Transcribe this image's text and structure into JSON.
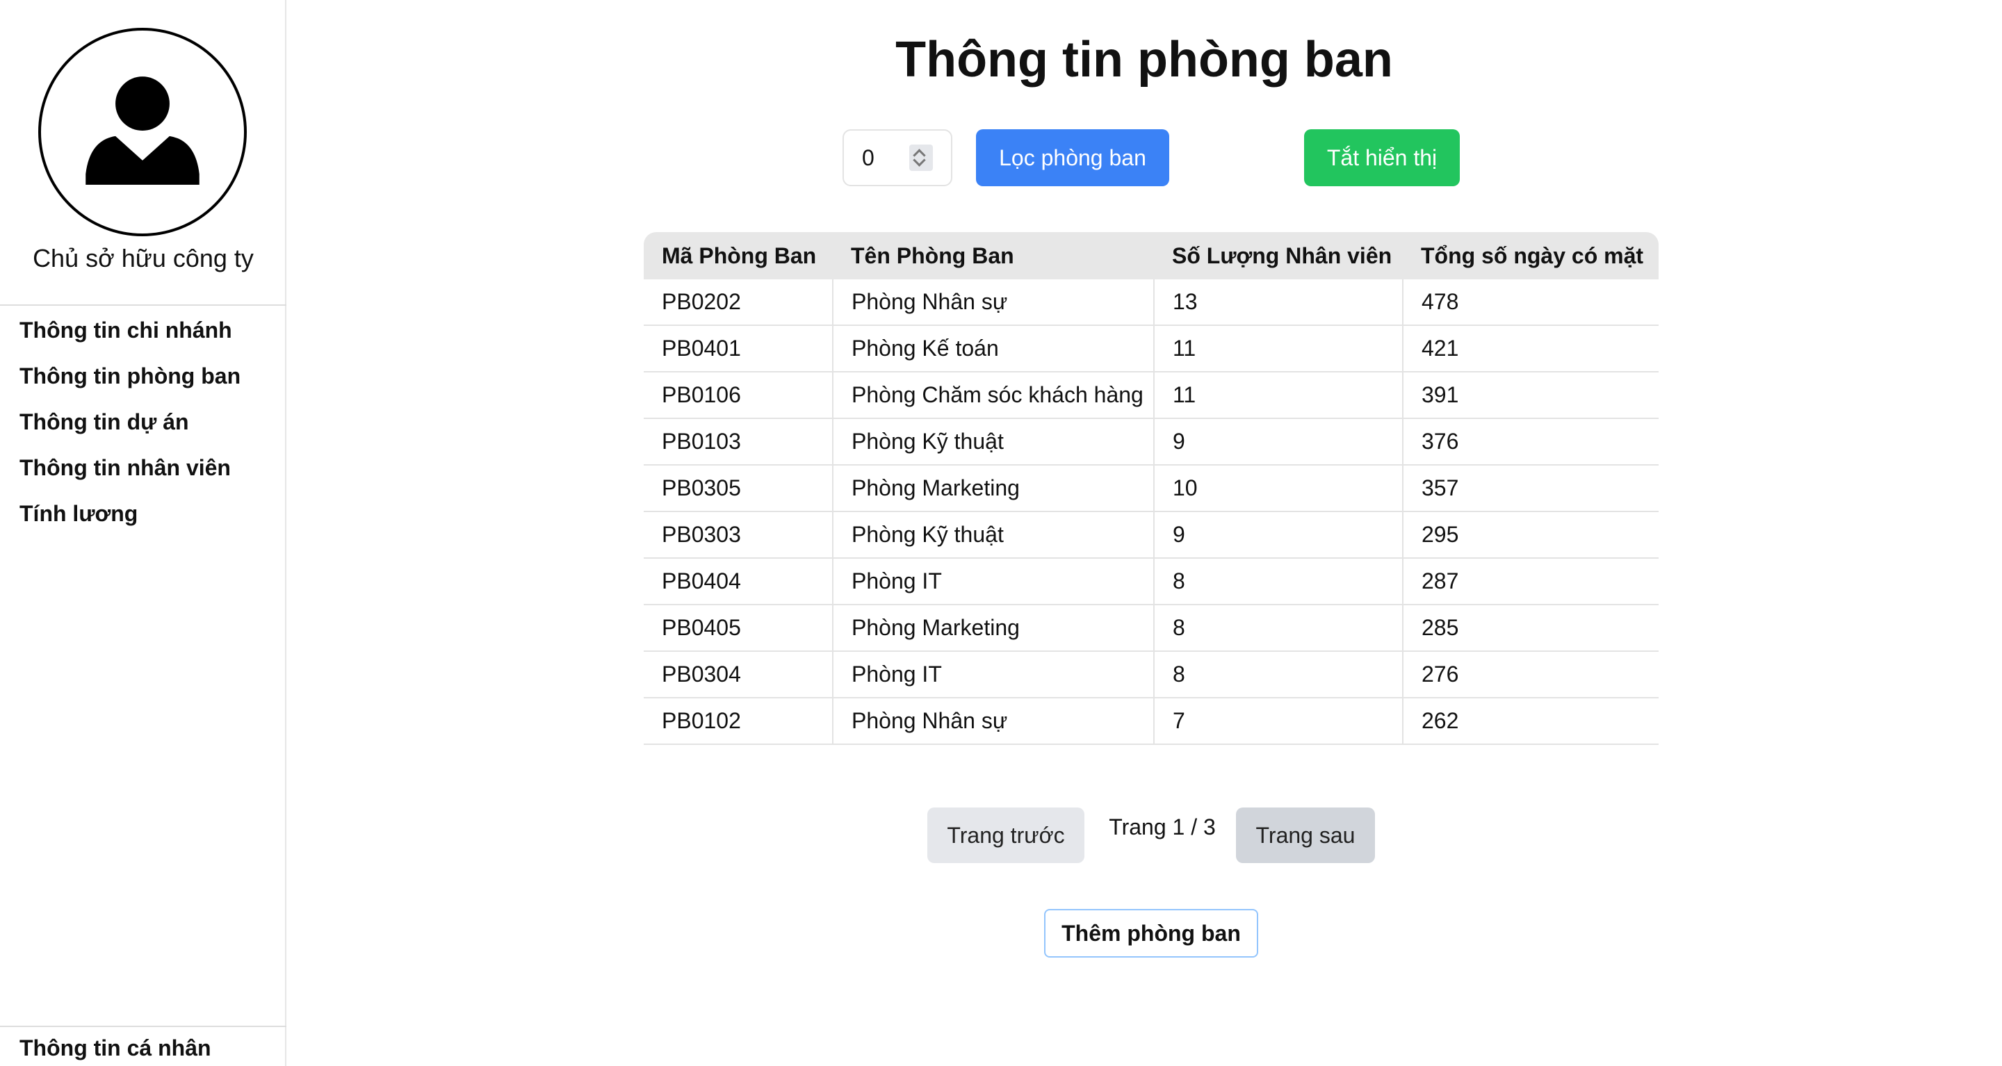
{
  "sidebar": {
    "avatar_icon": "user-tie-icon",
    "owner_name": "Chủ sở hữu công ty",
    "items": [
      {
        "label": "Thông tin chi nhánh"
      },
      {
        "label": "Thông tin phòng ban"
      },
      {
        "label": "Thông tin dự án"
      },
      {
        "label": "Thông tin nhân viên"
      },
      {
        "label": "Tính lương"
      }
    ],
    "bottom_item": "Thông tin cá nhân"
  },
  "main": {
    "title": "Thông tin phòng ban",
    "filter_input_value": "0",
    "filter_button": "Lọc phòng ban",
    "toggle_button": "Tắt hiển thị",
    "colors": {
      "filter_button": "#3b82f6",
      "toggle_button": "#22c55e",
      "add_border": "#93c5fd"
    },
    "table": {
      "headers": [
        "Mã Phòng Ban",
        "Tên Phòng Ban",
        "Số Lượng Nhân viên",
        "Tổng số ngày có mặt"
      ],
      "rows": [
        [
          "PB0202",
          "Phòng Nhân sự",
          "13",
          "478"
        ],
        [
          "PB0401",
          "Phòng Kế toán",
          "11",
          "421"
        ],
        [
          "PB0106",
          "Phòng Chăm sóc khách hàng",
          "11",
          "391"
        ],
        [
          "PB0103",
          "Phòng Kỹ thuật",
          "9",
          "376"
        ],
        [
          "PB0305",
          "Phòng Marketing",
          "10",
          "357"
        ],
        [
          "PB0303",
          "Phòng Kỹ thuật",
          "9",
          "295"
        ],
        [
          "PB0404",
          "Phòng IT",
          "8",
          "287"
        ],
        [
          "PB0405",
          "Phòng Marketing",
          "8",
          "285"
        ],
        [
          "PB0304",
          "Phòng IT",
          "8",
          "276"
        ],
        [
          "PB0102",
          "Phòng Nhân sự",
          "7",
          "262"
        ]
      ]
    },
    "pagination": {
      "prev_label": "Trang trước",
      "indicator": "Trang 1 / 3",
      "next_label": "Trang sau"
    },
    "add_button": "Thêm phòng ban"
  }
}
